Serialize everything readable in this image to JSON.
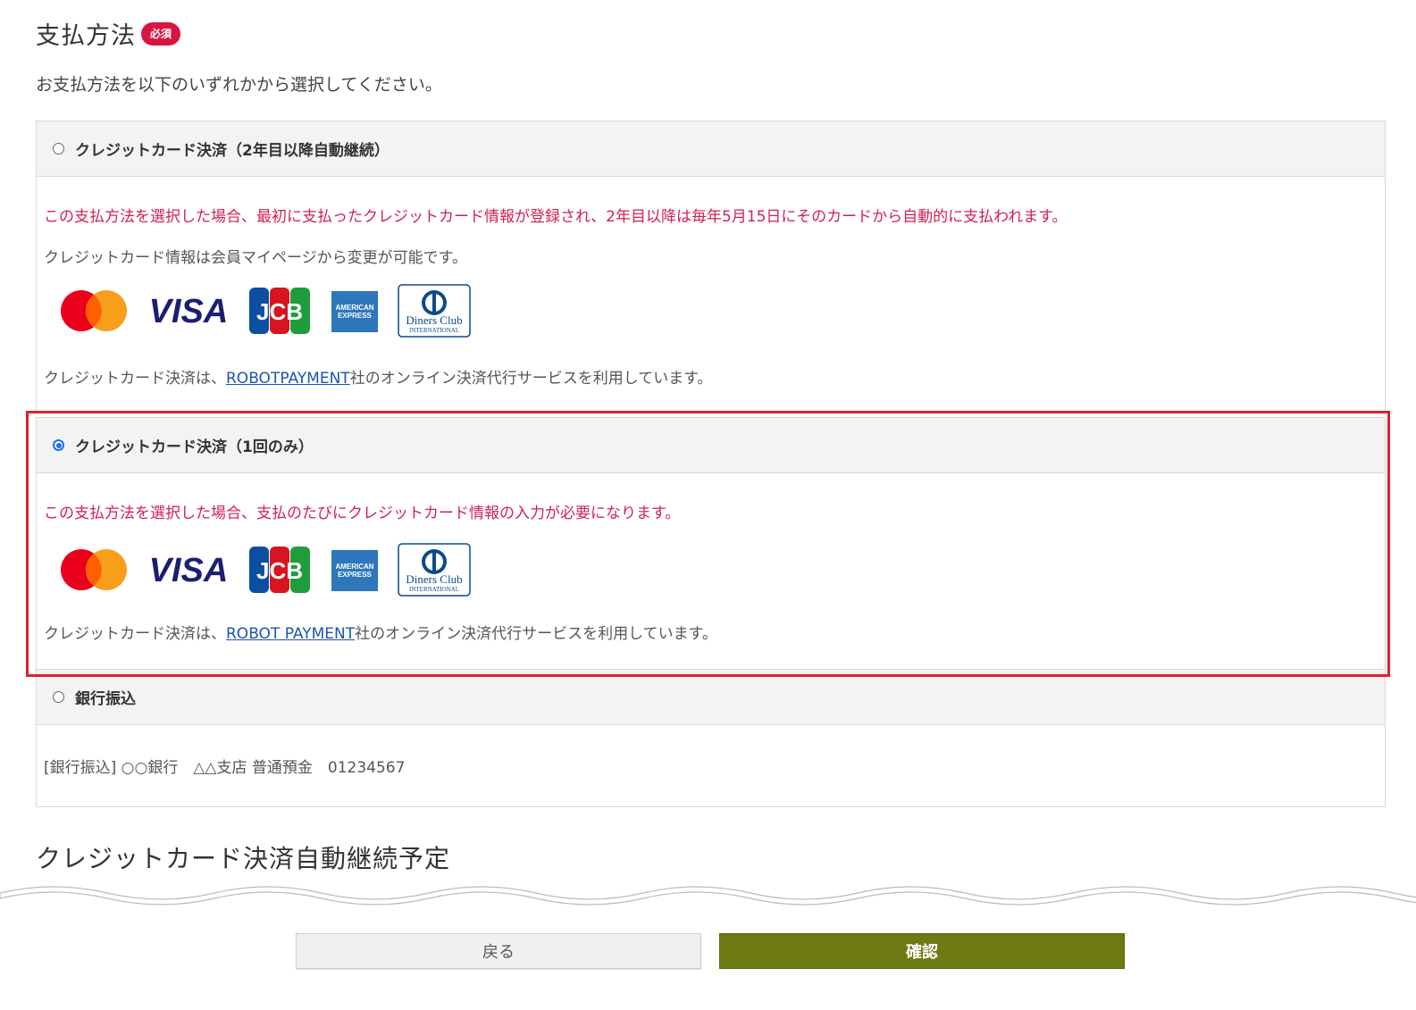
{
  "page": {
    "title": "支払方法",
    "required_badge": "必須",
    "subtitle": "お支払方法を以下のいずれかから選択してください。"
  },
  "options": [
    {
      "label": "クレジットカード決済（2年目以降自動継続）",
      "selected": false,
      "notice": "この支払方法を選択した場合、最初に支払ったクレジットカード情報が登録され、2年目以降は毎年5月15日にそのカードから自動的に支払われます。",
      "note": "クレジットカード情報は会員マイページから変更が可能です。",
      "provider_prefix": "クレジットカード決済は、",
      "provider_link": "ROBOTPAYMENT",
      "provider_suffix": "社のオンライン決済代行サービスを利用しています。"
    },
    {
      "label": "クレジットカード決済（1回のみ）",
      "selected": true,
      "notice": "この支払方法を選択した場合、支払のたびにクレジットカード情報の入力が必要になります。",
      "provider_prefix": "クレジットカード決済は、",
      "provider_link": "ROBOT PAYMENT",
      "provider_suffix": "社のオンライン決済代行サービスを利用しています。"
    },
    {
      "label": "銀行振込",
      "selected": false,
      "detail": "[銀行振込] ○○銀行　△△支店 普通預金　01234567"
    }
  ],
  "card_brands": [
    "mastercard-icon",
    "visa-icon",
    "jcb-icon",
    "amex-icon",
    "diners-club-icon"
  ],
  "card_logo_text": {
    "visa": "VISA",
    "jcb": "JCB",
    "amex_line1": "AMERICAN",
    "amex_line2": "EXPRESS",
    "diners_line1": "Diners Club",
    "diners_line2": "INTERNATIONAL"
  },
  "section2_title": "クレジットカード決済自動継続予定",
  "buttons": {
    "back": "戻る",
    "confirm": "確認"
  },
  "colors": {
    "required_badge": "#d7163f",
    "notice_text": "#d41f52",
    "link": "#1a55b3",
    "highlight_border": "#e02030",
    "confirm_button": "#6e7a12"
  }
}
